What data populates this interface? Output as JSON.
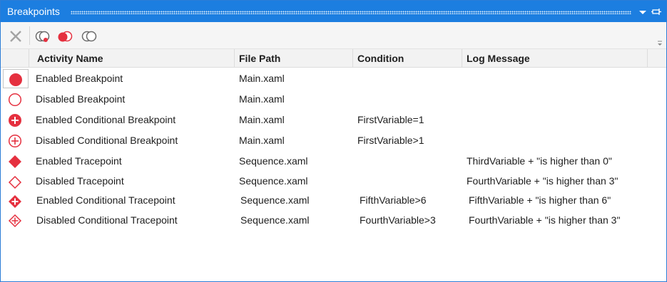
{
  "window": {
    "title": "Breakpoints"
  },
  "toolbar": {
    "delete_icon": "close-x-icon",
    "enable_all_icon": "enable-breakpoints-icon",
    "disable_all_icon": "disable-breakpoints-icon",
    "toggle_icon": "toggle-breakpoints-icon"
  },
  "columns": {
    "activity_name": "Activity Name",
    "file_path": "File Path",
    "condition": "Condition",
    "log_message": "Log Message"
  },
  "rows": [
    {
      "icon": "breakpoint-enabled",
      "name": "Enabled Breakpoint",
      "file": "Main.xaml",
      "condition": "",
      "log": ""
    },
    {
      "icon": "breakpoint-disabled",
      "name": "Disabled Breakpoint",
      "file": "Main.xaml",
      "condition": "",
      "log": ""
    },
    {
      "icon": "conditional-breakpoint-enabled",
      "name": "Enabled Conditional Breakpoint",
      "file": "Main.xaml",
      "condition": "FirstVariable=1",
      "log": ""
    },
    {
      "icon": "conditional-breakpoint-disabled",
      "name": "Disabled Conditional Breakpoint",
      "file": "Main.xaml",
      "condition": "FirstVariable>1",
      "log": ""
    },
    {
      "icon": "tracepoint-enabled",
      "name": "Enabled Tracepoint",
      "file": "Sequence.xaml",
      "condition": "",
      "log": "ThirdVariable + \"is higher than 0\""
    },
    {
      "icon": "tracepoint-disabled",
      "name": "Disabled Tracepoint",
      "file": "Sequence.xaml",
      "condition": "",
      "log": "FourthVariable + \"is higher than 3\""
    },
    {
      "icon": "conditional-tracepoint-enabled",
      "name": "Enabled Conditional Tracepoint",
      "file": "Sequence.xaml",
      "condition": "FifthVariable>6",
      "log": "FifthVariable + \"is higher than 6\""
    },
    {
      "icon": "conditional-tracepoint-disabled",
      "name": "Disabled Conditional Tracepoint",
      "file": "Sequence.xaml",
      "condition": "FourthVariable>3",
      "log": "FourthVariable + \"is higher than 3\""
    }
  ],
  "colors": {
    "title_bar": "#1c7ee0",
    "breakpoint_red": "#e5303f"
  }
}
